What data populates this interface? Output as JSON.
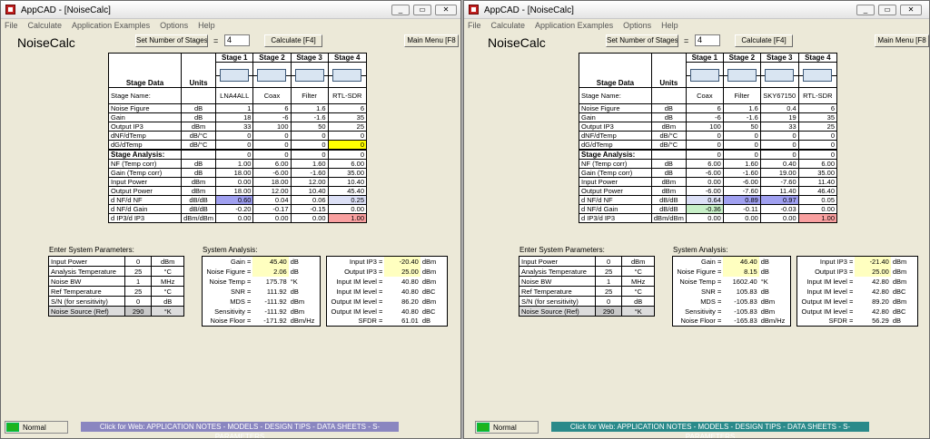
{
  "windows": [
    {
      "title": "AppCAD - [NoiseCalc]",
      "menu": [
        "File",
        "Calculate",
        "Application Examples",
        "Options",
        "Help"
      ],
      "heading": "NoiseCalc",
      "set_stages_label": "Set Number of Stages",
      "eq": "=",
      "num_stages": "4",
      "calc_label": "Calculate [F4]",
      "main_menu_label": "Main Menu [F8",
      "hdr": {
        "stage_data": "Stage Data",
        "units": "Units",
        "stages": [
          "Stage  1",
          "Stage  2",
          "Stage  3",
          "Stage  4"
        ],
        "stage_name": "Stage Name:",
        "analysis": "Stage Analysis:"
      },
      "names": [
        "LNA4ALL",
        "Coax",
        "Filter",
        "RTL-SDR"
      ],
      "rows": [
        {
          "label": "Noise Figure",
          "unit": "dB",
          "v": [
            "1",
            "6",
            "1.6",
            "6"
          ]
        },
        {
          "label": "Gain",
          "unit": "dB",
          "v": [
            "18",
            "-6",
            "-1.6",
            "35"
          ]
        },
        {
          "label": "Output IP3",
          "unit": "dBm",
          "v": [
            "33",
            "100",
            "50",
            "25"
          ]
        },
        {
          "label": "dNF/dTemp",
          "unit": "dB/°C",
          "v": [
            "0",
            "0",
            "0",
            "0"
          ]
        },
        {
          "label": "dG/dTemp",
          "unit": "dB/°C",
          "v": [
            "0",
            "0",
            "0",
            "0"
          ]
        }
      ],
      "analysis_zero": [
        "0",
        "0",
        "0",
        "0"
      ],
      "arows": [
        {
          "label": "NF (Temp corr)",
          "unit": "dB",
          "v": [
            "1.00",
            "6.00",
            "1.60",
            "6.00"
          ]
        },
        {
          "label": "Gain (Temp corr)",
          "unit": "dB",
          "v": [
            "18.00",
            "-6.00",
            "-1.60",
            "35.00"
          ]
        },
        {
          "label": "Input Power",
          "unit": "dBm",
          "v": [
            "0.00",
            "18.00",
            "12.00",
            "10.40"
          ]
        },
        {
          "label": "Output Power",
          "unit": "dBm",
          "v": [
            "18.00",
            "12.00",
            "10.40",
            "45.40"
          ]
        },
        {
          "label": "d NF/d NF",
          "unit": "dB/dB",
          "v": [
            "0.60",
            "0.04",
            "0.06",
            "0.25"
          ]
        },
        {
          "label": "d NF/d Gain",
          "unit": "dB/dB",
          "v": [
            "-0.20",
            "-0.17",
            "-0.15",
            "0.00"
          ]
        },
        {
          "label": "d IP3/d IP3",
          "unit": "dBm/dBm",
          "v": [
            "0.00",
            "0.00",
            "0.00",
            "1.00"
          ]
        }
      ],
      "esp_title": "Enter System Parameters:",
      "params": [
        {
          "label": "Input Power",
          "v": "0",
          "unit": "dBm"
        },
        {
          "label": "Analysis Temperature",
          "v": "25",
          "unit": "°C"
        },
        {
          "label": "Noise BW",
          "v": "1",
          "unit": "MHz"
        },
        {
          "label": "Ref Temperature",
          "v": "25",
          "unit": "°C"
        },
        {
          "label": "S/N (for sensitivity)",
          "v": "0",
          "unit": "dB"
        },
        {
          "label": "Noise Source (Ref)",
          "v": "290",
          "unit": "°K"
        }
      ],
      "sa_title": "System Analysis:",
      "sys1": [
        {
          "label": "Gain =",
          "v": "45.40",
          "unit": "dB"
        },
        {
          "label": "Noise Figure =",
          "v": "2.06",
          "unit": "dB"
        },
        {
          "label": "Noise Temp =",
          "v": "175.78",
          "unit": "°K"
        },
        {
          "label": "SNR =",
          "v": "111.92",
          "unit": "dB"
        },
        {
          "label": "MDS =",
          "v": "-111.92",
          "unit": "dBm"
        },
        {
          "label": "Sensitivity =",
          "v": "-111.92",
          "unit": "dBm"
        },
        {
          "label": "Noise Floor =",
          "v": "-171.92",
          "unit": "dBm/Hz"
        }
      ],
      "sys2": [
        {
          "label": "Input IP3 =",
          "v": "-20.40",
          "unit": "dBm"
        },
        {
          "label": "Output IP3 =",
          "v": "25.00",
          "unit": "dBm"
        },
        {
          "label": "Input IM level =",
          "v": "40.80",
          "unit": "dBm"
        },
        {
          "label": "Input IM level =",
          "v": "40.80",
          "unit": "dBC"
        },
        {
          "label": "Output IM level =",
          "v": "86.20",
          "unit": "dBm"
        },
        {
          "label": "Output IM level =",
          "v": "40.80",
          "unit": "dBC"
        },
        {
          "label": "SFDR =",
          "v": "61.01",
          "unit": "dB"
        }
      ],
      "status": "Normal",
      "web": "Click for Web: APPLICATION NOTES - MODELS - DESIGN TIPS - DATA SHEETS - S-PARAMETERS",
      "web_color": "#8a86c0"
    },
    {
      "title": "AppCAD - [NoiseCalc]",
      "menu": [
        "File",
        "Calculate",
        "Application Examples",
        "Options",
        "Help"
      ],
      "heading": "NoiseCalc",
      "set_stages_label": "Set Number of Stages",
      "eq": "=",
      "num_stages": "4",
      "calc_label": "Calculate [F4]",
      "main_menu_label": "Main Menu [F8",
      "hdr": {
        "stage_data": "Stage Data",
        "units": "Units",
        "stages": [
          "Stage  1",
          "Stage  2",
          "Stage  3",
          "Stage  4"
        ],
        "stage_name": "Stage Name:",
        "analysis": "Stage Analysis:"
      },
      "names": [
        "Coax",
        "Filter",
        "SKY67150",
        "RTL-SDR"
      ],
      "rows": [
        {
          "label": "Noise Figure",
          "unit": "dB",
          "v": [
            "6",
            "1.6",
            "0.4",
            "6"
          ]
        },
        {
          "label": "Gain",
          "unit": "dB",
          "v": [
            "-6",
            "-1.6",
            "19",
            "35"
          ]
        },
        {
          "label": "Output IP3",
          "unit": "dBm",
          "v": [
            "100",
            "50",
            "33",
            "25"
          ]
        },
        {
          "label": "dNF/dTemp",
          "unit": "dB/°C",
          "v": [
            "0",
            "0",
            "0",
            "0"
          ]
        },
        {
          "label": "dG/dTemp",
          "unit": "dB/°C",
          "v": [
            "0",
            "0",
            "0",
            "0"
          ]
        }
      ],
      "analysis_zero": [
        "0",
        "0",
        "0",
        "0"
      ],
      "arows": [
        {
          "label": "NF (Temp corr)",
          "unit": "dB",
          "v": [
            "6.00",
            "1.60",
            "0.40",
            "6.00"
          ]
        },
        {
          "label": "Gain (Temp corr)",
          "unit": "dB",
          "v": [
            "-6.00",
            "-1.60",
            "19.00",
            "35.00"
          ]
        },
        {
          "label": "Input Power",
          "unit": "dBm",
          "v": [
            "0.00",
            "-6.00",
            "-7.60",
            "11.40"
          ]
        },
        {
          "label": "Output Power",
          "unit": "dBm",
          "v": [
            "-6.00",
            "-7.60",
            "11.40",
            "46.40"
          ]
        },
        {
          "label": "d NF/d NF",
          "unit": "dB/dB",
          "v": [
            "0.64",
            "0.89",
            "0.97",
            "0.05"
          ]
        },
        {
          "label": "d NF/d Gain",
          "unit": "dB/dB",
          "v": [
            "-0.36",
            "-0.11",
            "-0.03",
            "0.00"
          ]
        },
        {
          "label": "d IP3/d IP3",
          "unit": "dBm/dBm",
          "v": [
            "0.00",
            "0.00",
            "0.00",
            "1.00"
          ]
        }
      ],
      "esp_title": "Enter System Parameters:",
      "params": [
        {
          "label": "Input Power",
          "v": "0",
          "unit": "dBm"
        },
        {
          "label": "Analysis Temperature",
          "v": "25",
          "unit": "°C"
        },
        {
          "label": "Noise BW",
          "v": "1",
          "unit": "MHz"
        },
        {
          "label": "Ref Temperature",
          "v": "25",
          "unit": "°C"
        },
        {
          "label": "S/N (for sensitivity)",
          "v": "0",
          "unit": "dB"
        },
        {
          "label": "Noise Source (Ref)",
          "v": "290",
          "unit": "°K"
        }
      ],
      "sa_title": "System Analysis:",
      "sys1": [
        {
          "label": "Gain =",
          "v": "46.40",
          "unit": "dB"
        },
        {
          "label": "Noise Figure =",
          "v": "8.15",
          "unit": "dB"
        },
        {
          "label": "Noise Temp =",
          "v": "1602.40",
          "unit": "°K"
        },
        {
          "label": "SNR =",
          "v": "105.83",
          "unit": "dB"
        },
        {
          "label": "MDS =",
          "v": "-105.83",
          "unit": "dBm"
        },
        {
          "label": "Sensitivity =",
          "v": "-105.83",
          "unit": "dBm"
        },
        {
          "label": "Noise Floor =",
          "v": "-165.83",
          "unit": "dBm/Hz"
        }
      ],
      "sys2": [
        {
          "label": "Input IP3 =",
          "v": "-21.40",
          "unit": "dBm"
        },
        {
          "label": "Output IP3 =",
          "v": "25.00",
          "unit": "dBm"
        },
        {
          "label": "Input IM level =",
          "v": "42.80",
          "unit": "dBm"
        },
        {
          "label": "Input IM level =",
          "v": "42.80",
          "unit": "dBC"
        },
        {
          "label": "Output IM level =",
          "v": "89.20",
          "unit": "dBm"
        },
        {
          "label": "Output IM level =",
          "v": "42.80",
          "unit": "dBC"
        },
        {
          "label": "SFDR =",
          "v": "56.29",
          "unit": "dB"
        }
      ],
      "status": "Normal",
      "web": "Click for Web: APPLICATION NOTES - MODELS - DESIGN TIPS - DATA SHEETS - S-PARAMETERS",
      "web_color": "#2a8a8a"
    }
  ]
}
